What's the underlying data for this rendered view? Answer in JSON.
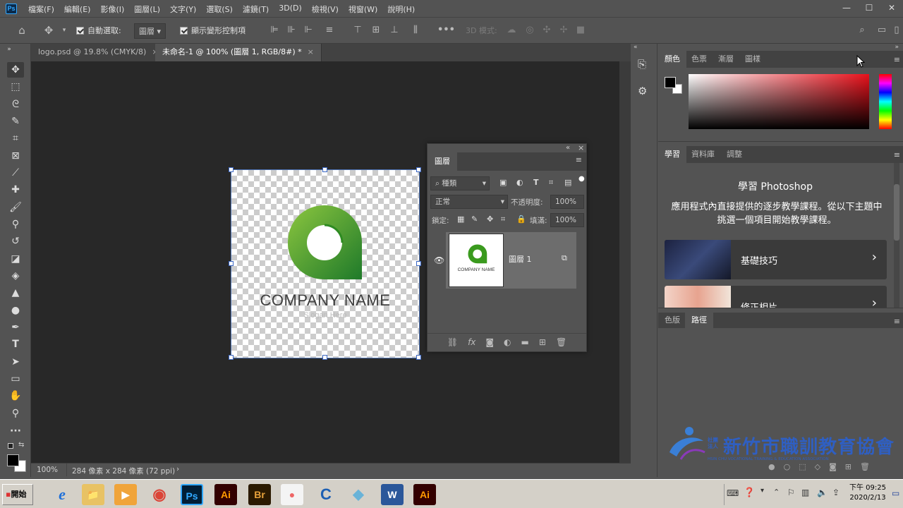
{
  "menubar": {
    "logo": "Ps",
    "items": [
      "檔案(F)",
      "編輯(E)",
      "影像(I)",
      "圖層(L)",
      "文字(Y)",
      "選取(S)",
      "濾鏡(T)",
      "3D(D)",
      "檢視(V)",
      "視窗(W)",
      "說明(H)"
    ],
    "minimize": "—",
    "maximize": "☐",
    "close": "✕"
  },
  "options": {
    "auto_select_label": "自動選取:",
    "auto_select_value": "圖層",
    "show_transform_label": "顯示變形控制項",
    "mode_3d_label": "3D 模式:",
    "more": "•••"
  },
  "tabs": [
    {
      "label": "logo.psd @ 19.8% (CMYK/8)",
      "close": "×"
    },
    {
      "label": "未命名-1 @ 100% (圖層 1, RGB/8#) *",
      "close": "×"
    }
  ],
  "document": {
    "company_name": "COMPANY NAME",
    "slogan": "Slogan Here"
  },
  "status": {
    "zoom": "100%",
    "size": "284 像素 x 284 像素 (72 ppi)",
    "arrow": "›"
  },
  "layers_panel": {
    "title": "圖層",
    "filter_label": "種類",
    "blend_mode": "正常",
    "opacity_label": "不透明度:",
    "opacity_value": "100%",
    "lock_label": "鎖定:",
    "fill_label": "填滿:",
    "fill_value": "100%",
    "layer_name": "圖層 1",
    "thumb_company": "COMPANY NAME",
    "collapse": "«",
    "close": "×"
  },
  "color_panel": {
    "tabs": [
      "顏色",
      "色票",
      "漸層",
      "圖樣"
    ]
  },
  "learn_panel": {
    "tabs": [
      "學習",
      "資料庫",
      "調整"
    ],
    "heading": "學習 Photoshop",
    "description": "應用程式內直接提供的逐步教學課程。從以下主題中挑選一個項目開始教學課程。",
    "cards": [
      {
        "label": "基礎技巧",
        "arrow": "›"
      },
      {
        "label": "修正相片",
        "arrow": "›"
      }
    ]
  },
  "paths_panel": {
    "tabs": [
      "色版",
      "路徑"
    ]
  },
  "watermark": {
    "org_name": "新竹市職訓教育協會",
    "org_prefix": "社團法人",
    "org_english": "HSIN CHU VOCATIONAL TRAINING & EDUCATION ASSOCIATION"
  },
  "taskbar": {
    "start_label": "開始",
    "apps": [
      "e",
      "📁",
      "▶",
      "◉",
      "Ps",
      "Ai",
      "Br",
      "●",
      "C",
      "◆",
      "W",
      "Ai"
    ],
    "clock_time": "下午 09:25",
    "clock_date": "2020/2/13"
  },
  "colors": {
    "ps_blue": "#31a8ff",
    "logo_green": "#3a9a1e",
    "panel_bg": "#535353",
    "canvas_bg": "#282828"
  }
}
